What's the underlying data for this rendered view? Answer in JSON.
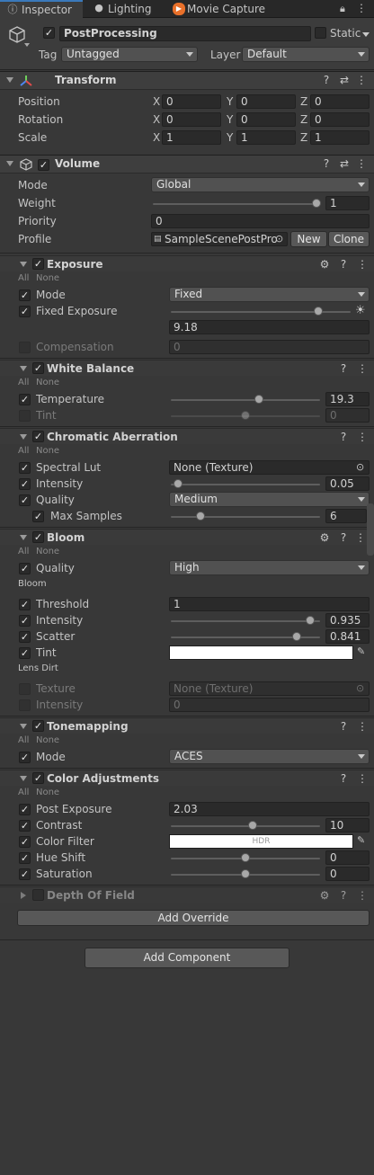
{
  "tabs": [
    {
      "label": "Inspector",
      "icon": "info-icon"
    },
    {
      "label": "Lighting",
      "icon": "lightbulb-icon"
    },
    {
      "label": "Movie Capture",
      "icon": "movie-capture-icon"
    }
  ],
  "object": {
    "name": "PostProcessing",
    "static_label": "Static",
    "tag_label": "Tag",
    "tag_value": "Untagged",
    "layer_label": "Layer",
    "layer_value": "Default"
  },
  "transform": {
    "title": "Transform",
    "rows": [
      {
        "label": "Position",
        "x": "0",
        "y": "0",
        "z": "0"
      },
      {
        "label": "Rotation",
        "x": "0",
        "y": "0",
        "z": "0"
      },
      {
        "label": "Scale",
        "x": "1",
        "y": "1",
        "z": "1"
      }
    ],
    "axis": {
      "x": "X",
      "y": "Y",
      "z": "Z"
    }
  },
  "volume": {
    "title": "Volume",
    "mode_label": "Mode",
    "mode_value": "Global",
    "weight_label": "Weight",
    "weight_value": "1",
    "weight_fraction": 1.0,
    "priority_label": "Priority",
    "priority_value": "0",
    "profile_label": "Profile",
    "profile_value": "SampleScenePostPro",
    "new_label": "New",
    "clone_label": "Clone"
  },
  "common": {
    "all": "All",
    "none": "None"
  },
  "exposure": {
    "title": "Exposure",
    "mode_label": "Mode",
    "mode_value": "Fixed",
    "fixed_label": "Fixed Exposure",
    "fixed_value": "9.18",
    "fixed_fraction": 0.82,
    "comp_label": "Compensation",
    "comp_value": "0"
  },
  "white_balance": {
    "title": "White Balance",
    "temp_label": "Temperature",
    "temp_value": "19.3",
    "temp_fraction": 0.59,
    "tint_label": "Tint",
    "tint_value": "0",
    "tint_fraction": 0.5
  },
  "chromatic": {
    "title": "Chromatic Aberration",
    "lut_label": "Spectral Lut",
    "lut_value": "None (Texture)",
    "intensity_label": "Intensity",
    "intensity_value": "0.05",
    "intensity_fraction": 0.05,
    "quality_label": "Quality",
    "quality_value": "Medium",
    "samples_label": "Max Samples",
    "samples_value": "6",
    "samples_fraction": 0.2
  },
  "bloom": {
    "title": "Bloom",
    "quality_label": "Quality",
    "quality_value": "High",
    "section_bloom": "Bloom",
    "threshold_label": "Threshold",
    "threshold_value": "1",
    "intensity_label": "Intensity",
    "intensity_value": "0.935",
    "intensity_fraction": 0.935,
    "scatter_label": "Scatter",
    "scatter_value": "0.841",
    "scatter_fraction": 0.841,
    "tint_label": "Tint",
    "section_lens": "Lens Dirt",
    "texture_label": "Texture",
    "texture_value": "None (Texture)",
    "dirt_intensity_label": "Intensity",
    "dirt_intensity_value": "0"
  },
  "tonemapping": {
    "title": "Tonemapping",
    "mode_label": "Mode",
    "mode_value": "ACES"
  },
  "color_adjustments": {
    "title": "Color Adjustments",
    "post_label": "Post Exposure",
    "post_value": "2.03",
    "contrast_label": "Contrast",
    "contrast_value": "10",
    "contrast_fraction": 0.55,
    "filter_label": "Color Filter",
    "filter_badge": "HDR",
    "hue_label": "Hue Shift",
    "hue_value": "0",
    "hue_fraction": 0.5,
    "sat_label": "Saturation",
    "sat_value": "0",
    "sat_fraction": 0.5
  },
  "dof": {
    "title": "Depth Of Field"
  },
  "buttons": {
    "add_override": "Add Override",
    "add_component": "Add Component"
  }
}
